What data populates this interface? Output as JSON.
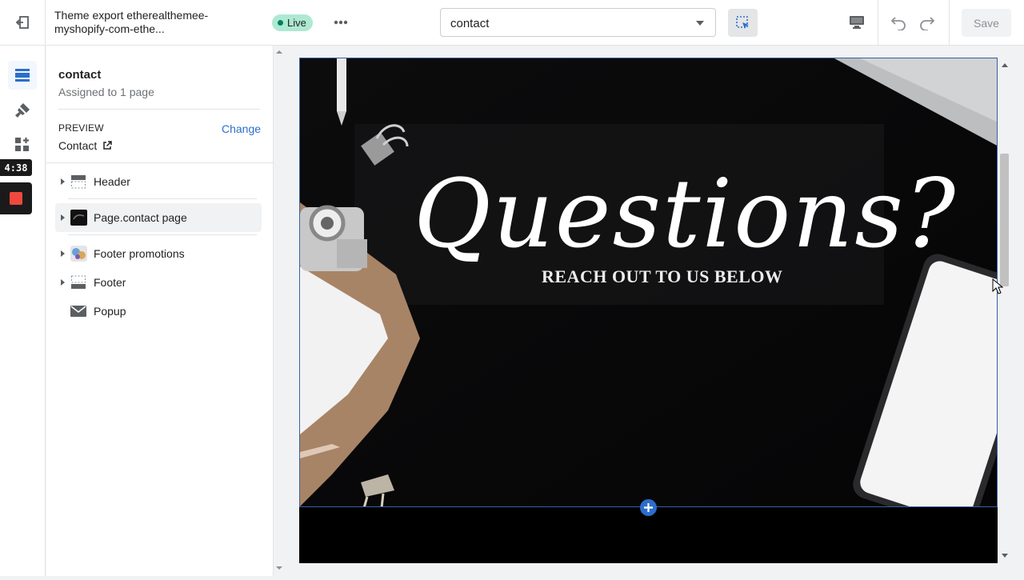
{
  "topbar": {
    "theme_name": "Theme export etherealthemee-myshopify-com-ethe...",
    "live_label": "Live",
    "page_select_value": "contact",
    "save_label": "Save"
  },
  "rail": {
    "timer": "4:38"
  },
  "sidebar": {
    "template_title": "contact",
    "assigned": "Assigned to 1 page",
    "preview_label": "PREVIEW",
    "preview_change": "Change",
    "preview_value": "Contact",
    "sections": [
      {
        "label": "Header",
        "expandable": true
      },
      {
        "label": "Page.contact page",
        "expandable": true
      },
      {
        "label": "Footer promotions",
        "expandable": true
      },
      {
        "label": "Footer",
        "expandable": true
      },
      {
        "label": "Popup",
        "expandable": false
      }
    ]
  },
  "canvas": {
    "hero_script": "Questions?",
    "hero_subtitle": "REACH OUT TO US BELOW"
  },
  "colors": {
    "accent": "#2c6ecb",
    "live_bg": "#aee9d1",
    "record": "#f0483e"
  }
}
